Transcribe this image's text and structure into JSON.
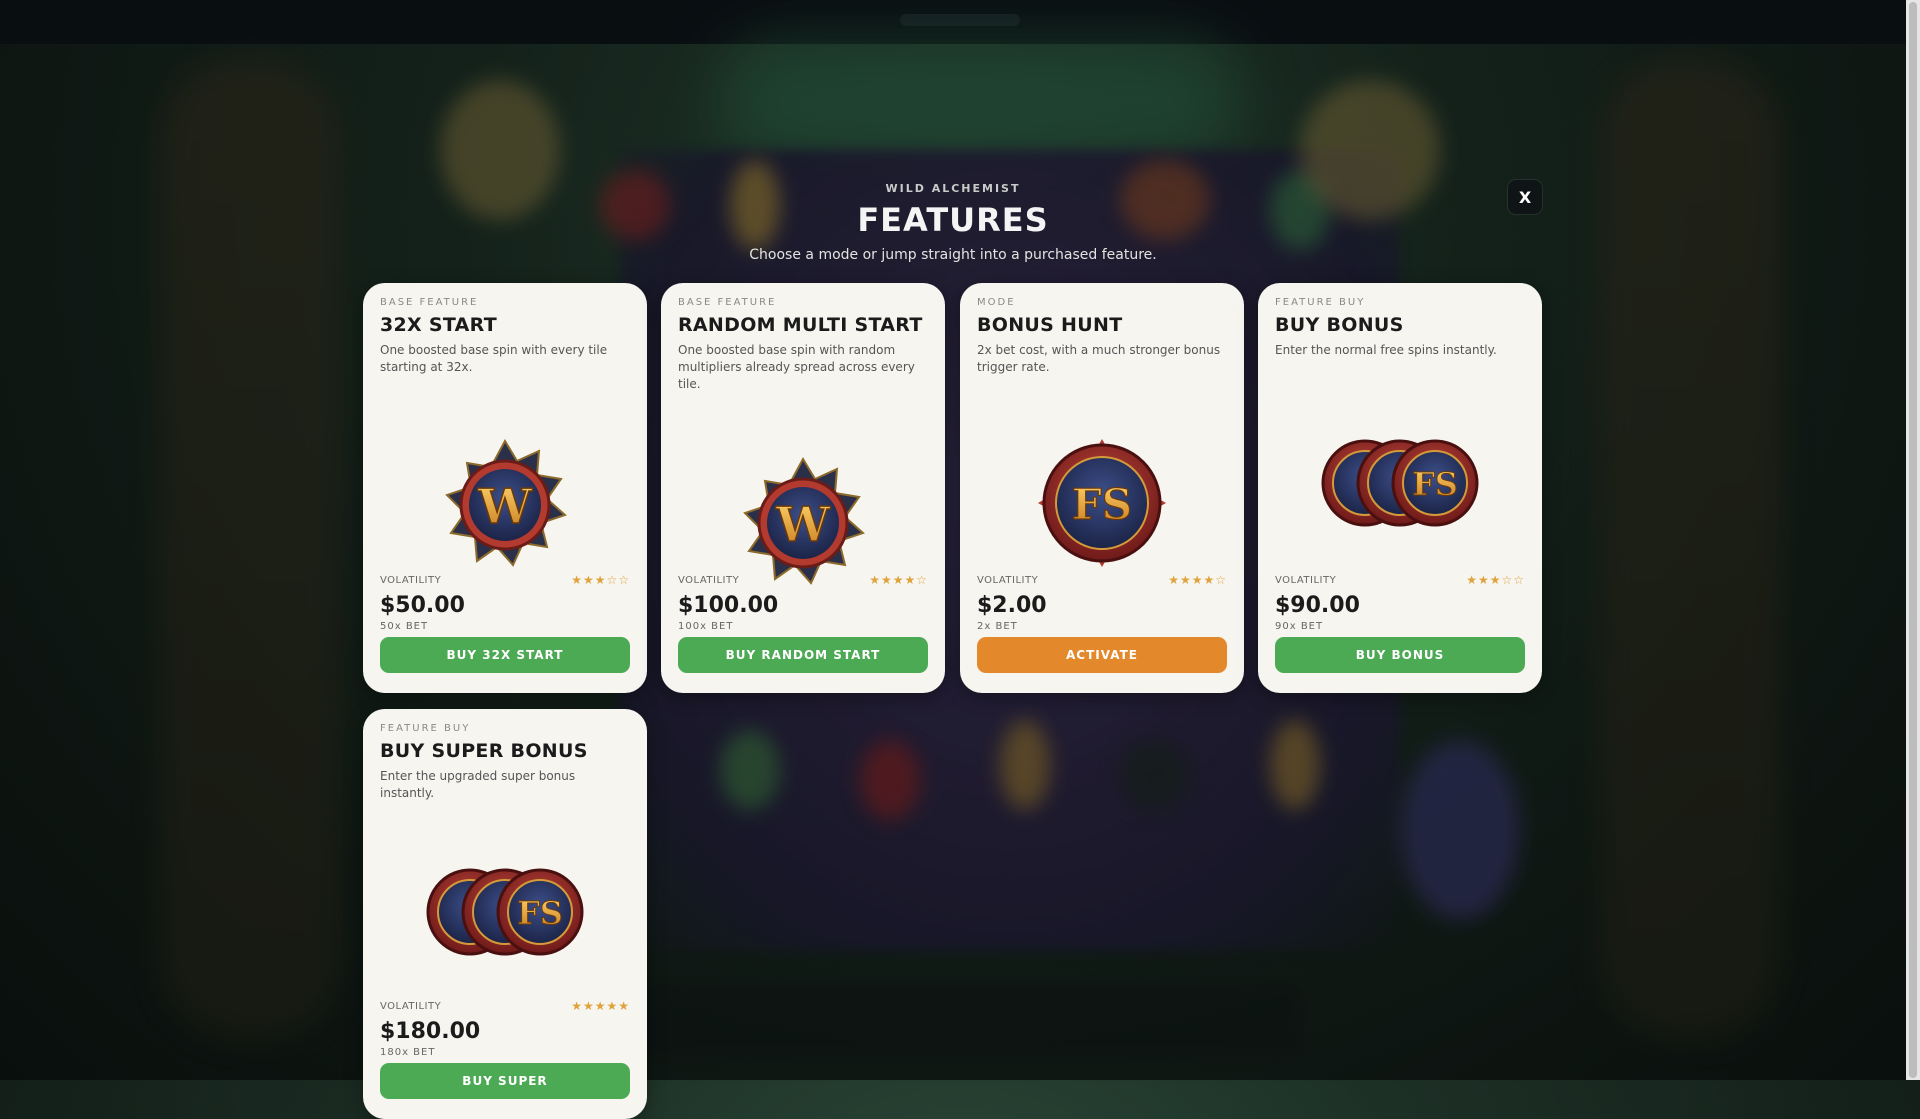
{
  "header": {
    "eyebrow": "WILD ALCHEMIST",
    "title": "FEATURES",
    "subtitle": "Choose a mode or jump straight into a purchased feature.",
    "close_label": "X"
  },
  "cards": [
    {
      "kicker": "BASE FEATURE",
      "title": "32X START",
      "description": "One boosted base spin with every tile starting at 32x.",
      "icon": "w-badge-icon",
      "volatility_label": "VOLATILITY",
      "volatility_rating": 3.5,
      "volatility_stars": "★★★☆☆",
      "price": "$50.00",
      "bet": "50x BET",
      "button_label": "BUY 32X START",
      "button_color": "#4caa55"
    },
    {
      "kicker": "BASE FEATURE",
      "title": "RANDOM MULTI START",
      "description": "One boosted base spin with random multipliers already spread across every tile.",
      "icon": "w-badge-icon",
      "volatility_label": "VOLATILITY",
      "volatility_rating": 4,
      "volatility_stars": "★★★★☆",
      "price": "$100.00",
      "bet": "100x BET",
      "button_label": "BUY RANDOM START",
      "button_color": "#4caa55"
    },
    {
      "kicker": "MODE",
      "title": "BONUS HUNT",
      "description": "2x bet cost, with a much stronger bonus trigger rate.",
      "icon": "fs-coin-icon",
      "volatility_label": "VOLATILITY",
      "volatility_rating": 4,
      "volatility_stars": "★★★★☆",
      "price": "$2.00",
      "bet": "2x BET",
      "button_label": "ACTIVATE",
      "button_color": "#e3892c"
    },
    {
      "kicker": "FEATURE BUY",
      "title": "BUY BONUS",
      "description": "Enter the normal free spins instantly.",
      "icon": "fs-coin-stack-icon",
      "volatility_label": "VOLATILITY",
      "volatility_rating": 3.5,
      "volatility_stars": "★★★☆☆",
      "price": "$90.00",
      "bet": "90x BET",
      "button_label": "BUY BONUS",
      "button_color": "#4caa55"
    },
    {
      "kicker": "FEATURE BUY",
      "title": "BUY SUPER BONUS",
      "description": "Enter the upgraded super bonus instantly.",
      "icon": "fs-coin-stack-icon",
      "volatility_label": "VOLATILITY",
      "volatility_rating": 5,
      "volatility_stars": "★★★★★",
      "price": "$180.00",
      "bet": "180x BET",
      "button_label": "BUY SUPER",
      "button_color": "#4caa55"
    }
  ]
}
